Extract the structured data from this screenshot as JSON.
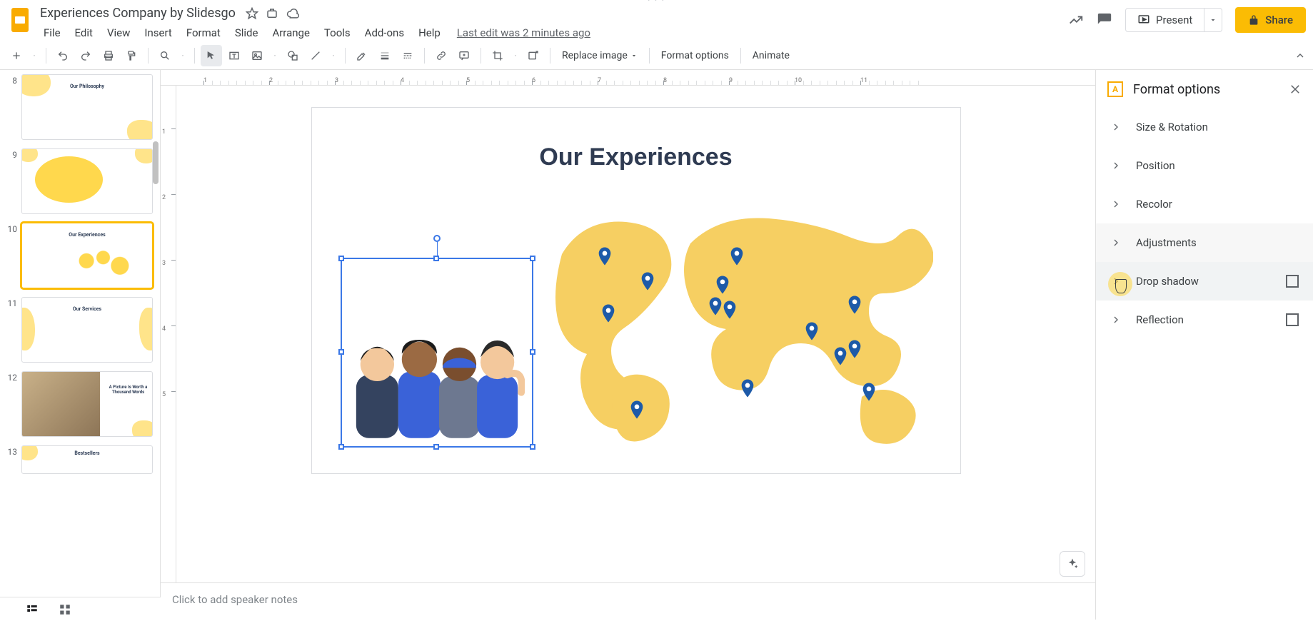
{
  "doc": {
    "title": "Experiences Company by Slidesgo",
    "last_edit": "Last edit was 2 minutes ago"
  },
  "menus": {
    "file": "File",
    "edit": "Edit",
    "view": "View",
    "insert": "Insert",
    "format": "Format",
    "slide": "Slide",
    "arrange": "Arrange",
    "tools": "Tools",
    "addons": "Add-ons",
    "help": "Help"
  },
  "title_actions": {
    "present": "Present",
    "share": "Share"
  },
  "toolbar": {
    "replace_image": "Replace image",
    "format_options": "Format options",
    "animate": "Animate"
  },
  "filmstrip": {
    "numbers": [
      "8",
      "9",
      "10",
      "11",
      "12",
      "13"
    ],
    "labels": [
      "Our Philosophy",
      "",
      "Our Experiences",
      "Our Services",
      "A Picture Is Worth a Thousand Words",
      "Bestsellers"
    ]
  },
  "canvas": {
    "slide_title": "Our Experiences"
  },
  "notes": {
    "placeholder": "Click to add speaker notes"
  },
  "sidebar": {
    "title": "Format options",
    "sections": {
      "size": "Size & Rotation",
      "position": "Position",
      "recolor": "Recolor",
      "adjust": "Adjustments",
      "shadow": "Drop shadow",
      "reflect": "Reflection"
    }
  },
  "ruler_h": [
    "1",
    "2",
    "3",
    "4",
    "5",
    "6",
    "7",
    "8",
    "9",
    "10",
    "11"
  ],
  "ruler_v": [
    "1",
    "2",
    "3",
    "4",
    "5"
  ]
}
